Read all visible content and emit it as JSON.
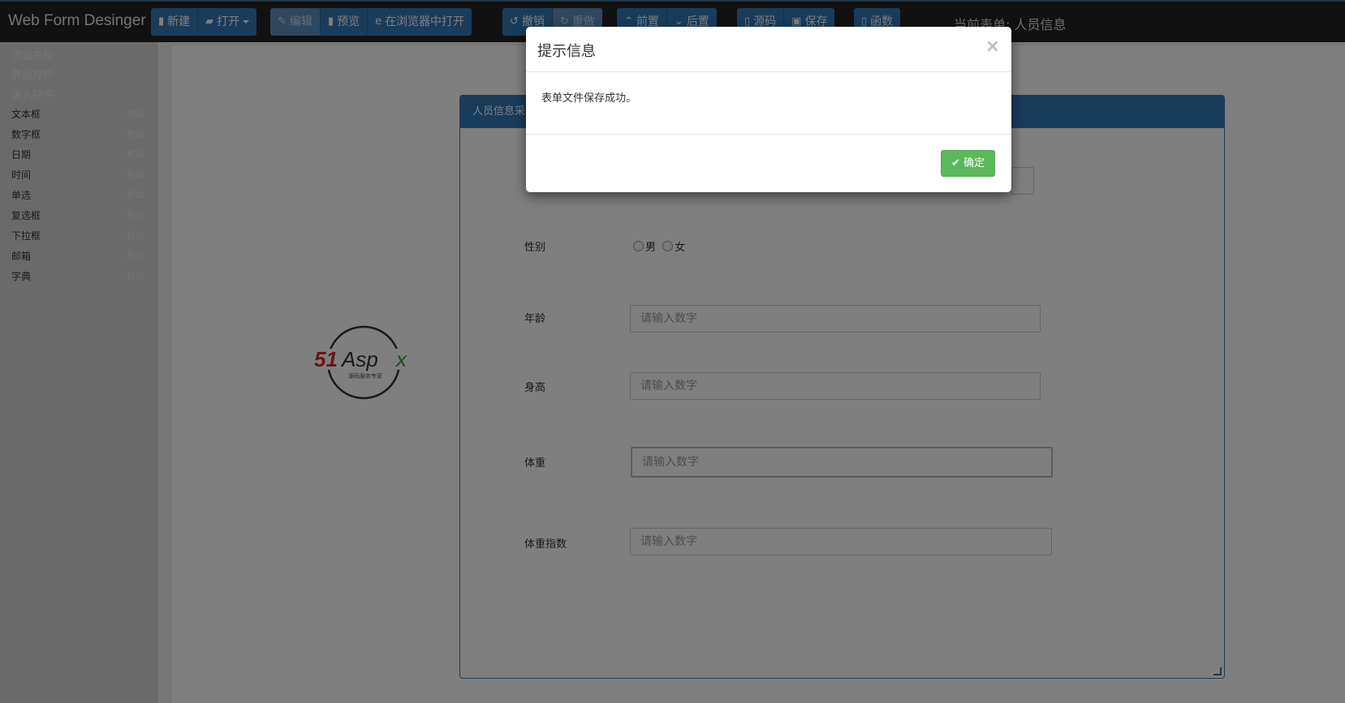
{
  "app": {
    "brand": "Web Form Desinger",
    "current_form_label": "当前表单: 人员信息"
  },
  "toolbar": {
    "new": "新建",
    "open": "打开",
    "edit": "编辑",
    "preview": "预览",
    "open_in_browser": "在浏览器中打开",
    "undo": "撤销",
    "redo": "重做",
    "bring_front": "前置",
    "send_back": "后置",
    "source": "源码",
    "save": "保存",
    "functions": "函数"
  },
  "sidebar": {
    "sections": [
      "页面布局",
      "界面控件",
      "录入控件"
    ],
    "drag_label": "拖动",
    "items": [
      "文本框",
      "数字框",
      "日期",
      "时间",
      "单选",
      "复选框",
      "下拉框",
      "邮箱",
      "字典"
    ]
  },
  "logo": {
    "main": "51Aspx",
    "tagline": "源码服务专家"
  },
  "form": {
    "panel_title": "人员信息采",
    "gender_label": "性别",
    "gender_male": "男",
    "gender_female": "女",
    "age_label": "年龄",
    "height_label": "身高",
    "weight_label": "体重",
    "bmi_label": "体重指数",
    "placeholder": "请输入数字"
  },
  "modal": {
    "title": "提示信息",
    "close": "×",
    "message": "表单文件保存成功。",
    "ok": "确定"
  },
  "colors": {
    "primary": "#3379b7",
    "success": "#5cb85c",
    "navbar": "#222222"
  }
}
